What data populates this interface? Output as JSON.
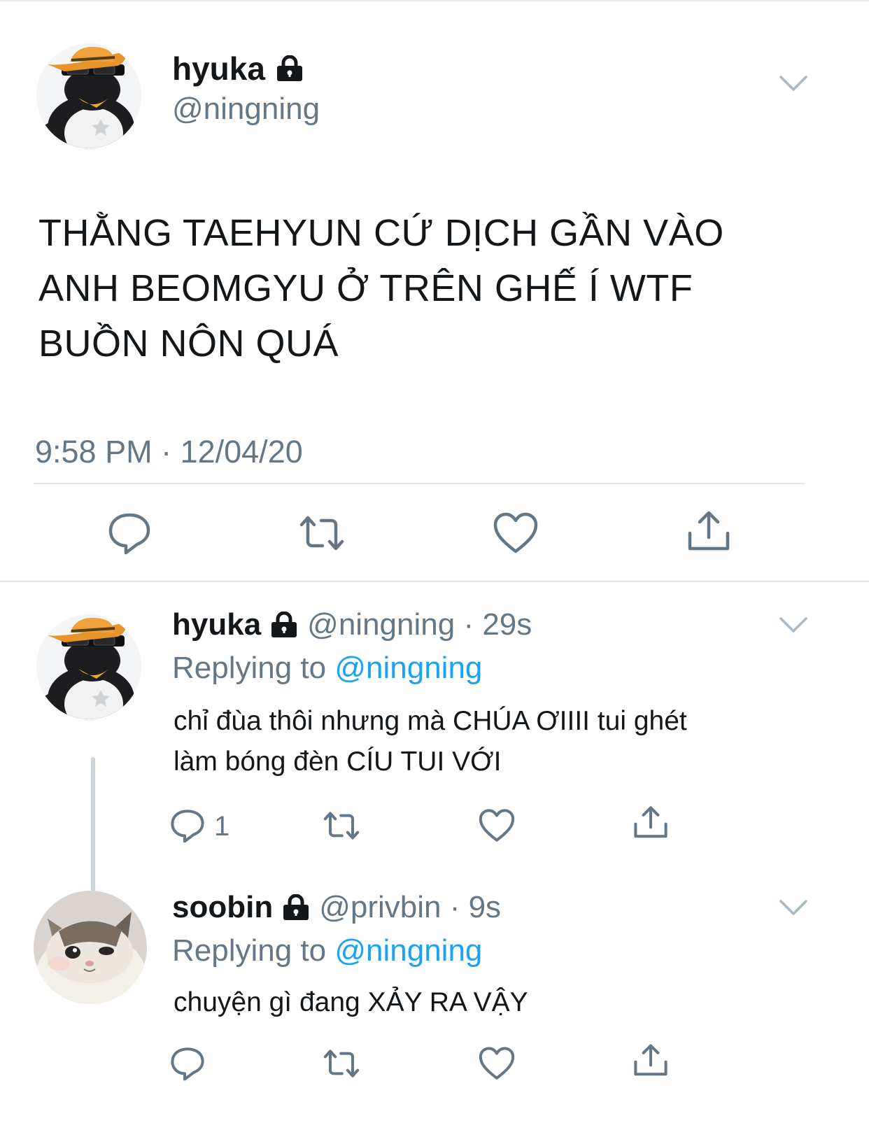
{
  "main_tweet": {
    "display_name": "hyuka",
    "handle": "@ningning",
    "text_lines": [
      "THẰNG TAEHYUN CỨ DỊCH GẦN VÀO",
      "ANH BEOMGYU Ở TRÊN GHẾ Í WTF",
      "BUỒN NÔN QUÁ"
    ],
    "timestamp": "9:58 PM · 12/04/20"
  },
  "replies": [
    {
      "display_name": "hyuka",
      "handle": "@ningning · 29s",
      "replying_prefix": "Replying to ",
      "replying_mention": "@ningning",
      "text_lines": [
        "chỉ đùa thôi nhưng mà CHÚA ƠIIII tui ghét",
        "làm bóng đèn CÍU TUI VỚI"
      ],
      "reply_count": "1"
    },
    {
      "display_name": "soobin",
      "handle": "@privbin · 9s",
      "replying_prefix": "Replying to ",
      "replying_mention": "@ningning",
      "text_lines": [
        "chuyện gì đang XẢY RA VẬY"
      ],
      "reply_count": ""
    }
  ],
  "colors": {
    "text": "#14171a",
    "secondary": "#657786",
    "accent": "#1da1f2",
    "divider": "#e1e8ed",
    "icon": "#657786"
  },
  "icons": [
    "lock-icon",
    "chevron-down-icon",
    "reply-icon",
    "retweet-icon",
    "like-icon",
    "share-icon"
  ]
}
